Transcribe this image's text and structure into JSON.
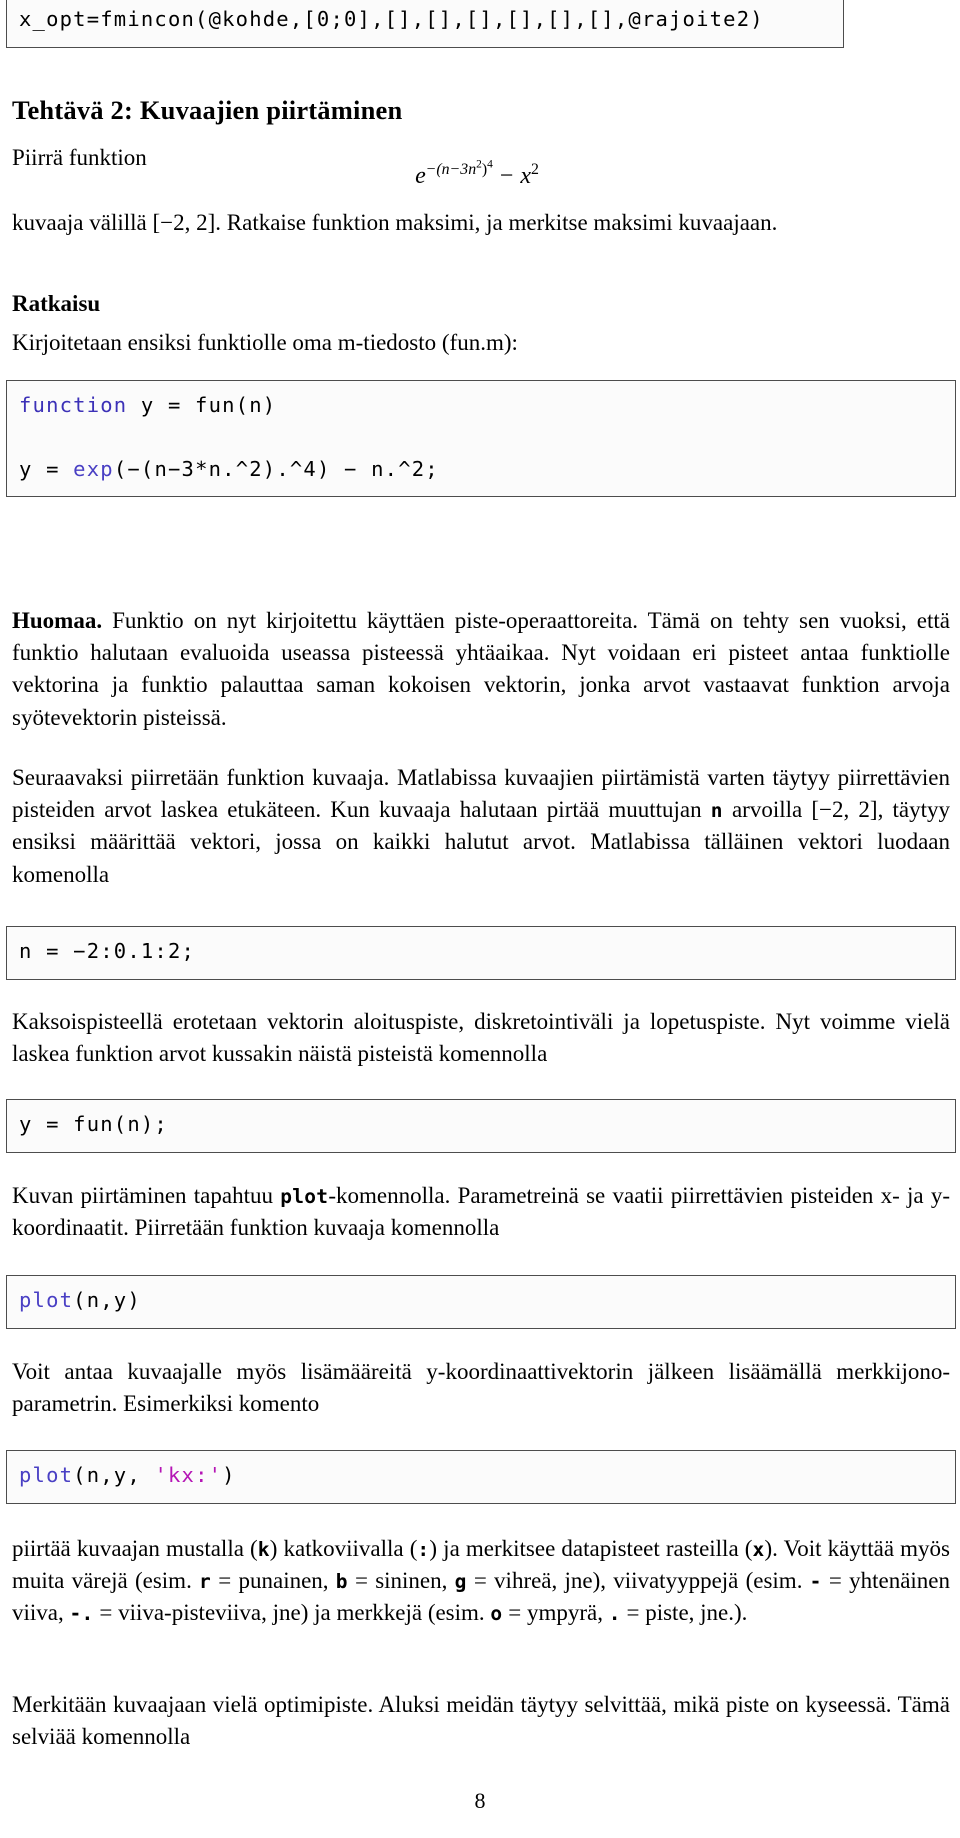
{
  "document": {
    "page_number": "8",
    "top_code_fragment": "x_opt=fmincon(@kohde,[0;0],[],[],[],[],[],[],@rajoite2)",
    "section_title": "Tehtävä 2: Kuvaajien piirtäminen",
    "intro_lead": "Piirrä funktion",
    "formula": {
      "base": "e",
      "exponent_text": "−(n−3n²)⁴",
      "exp_inner_lead": "−(n−3n",
      "exp_inner_sup": "2",
      "exp_inner_close": ")",
      "exp_outer_sup": "4",
      "minus": "−",
      "second_term_base": "x",
      "second_term_sup": "2",
      "plain": "e^{-(n-3n^2)^4} - x^2"
    },
    "intro_tail": "kuvaaja välillä [−2, 2]. Ratkaise funktion maksimi, ja merkitse maksimi kuvaajaan.",
    "solution_heading": "Ratkaisu",
    "para_mfile": "Kirjoitetaan ensiksi funktiolle oma m-tiedosto (fun.m):",
    "code_fun": {
      "keyword": "function",
      "line1_rest": " y = fun(n)",
      "line2_pre": "y = ",
      "line2_fn": "exp",
      "line2_rest": "(−(n−3*n.^2).^4) − n.^2;"
    },
    "para_huomaa": {
      "label": "Huomaa.",
      "text": " Funktio on nyt kirjoitettu käyttäen piste-operaattoreita. Tämä on tehty sen vuoksi, että funktio halutaan evaluoida useassa pisteessä yhtäaikaa. Nyt voidaan eri pisteet antaa funktiolle vektorina ja funktio palauttaa saman kokoisen vektorin, jonka arvot vastaavat funktion arvoja syötevektorin pisteissä."
    },
    "para_seuraavaksi_1": "Seuraavaksi piirretään funktion kuvaaja. Matlabissa kuvaajien piirtämistä varten täytyy piirrettävien pisteiden arvot laskea etukäteen. Kun kuvaaja halutaan pirtää muuttujan ",
    "para_seuraavaksi_mono": "n",
    "para_seuraavaksi_2": " arvoilla [−2, 2], täytyy ensiksi määrittää vektori, jossa on kaikki halutut arvot. Matlabissa tälläinen vektori luodaan komenolla",
    "code_n": "n = −2:0.1:2;",
    "para_kaksoispisteella": "Kaksoispisteellä erotetaan vektorin aloituspiste, diskretointiväli ja lopetuspiste. Nyt voimme vielä laskea funktion arvot kussakin näistä pisteistä komennolla",
    "code_y": "y = fun(n);",
    "para_kuvan_1": "Kuvan piirtäminen tapahtuu ",
    "para_kuvan_mono": "plot",
    "para_kuvan_2": "-komennolla. Parametreinä se vaatii piirrettävien pisteiden x- ja y-koordinaatit. Piirretään funktion kuvaaja komennolla",
    "code_plot": {
      "fn": "plot",
      "rest": "(n,y)"
    },
    "para_voit_antaa": "Voit antaa kuvaajalle myös lisämääreitä y-koordinaattivektorin jälkeen lisäämällä merkkijono-parametrin. Esimerkiksi komento",
    "code_plot_style": {
      "fn": "plot",
      "args_pre": "(n,y, ",
      "string": "'kx:'",
      "args_post": ")"
    },
    "para_piirtaa": {
      "seg1": "piirtää kuvaajan mustalla (",
      "m1": "k",
      "seg2": ") katkoviivalla (",
      "m2": ":",
      "seg3": ") ja merkitsee datapisteet rasteilla (",
      "m3": "x",
      "seg4": "). Voit käyttää myös muita värejä (esim. ",
      "m4": "r",
      "seg5": " = punainen, ",
      "m5": "b",
      "seg6": " = sininen, ",
      "m6": "g",
      "seg7": " = vihreä, jne), viivatyyppejä (esim. ",
      "m7": "-",
      "seg8": " = yhtenäinen viiva, ",
      "m8": "-.",
      "seg9": " = viiva-pisteviiva, jne) ja merkkejä (esim. ",
      "m9": "o",
      "seg10": " = ympyrä, ",
      "m10": ".",
      "seg11": " = piste, jne.)."
    },
    "para_merkitaan": "Merkitään kuvaajaan vielä optimipiste. Aluksi meidän täytyy selvittää, mikä piste on kyseessä. Tämä selviää komennolla"
  },
  "colors": {
    "keyword": "#3c31b7",
    "function": "#4a40c4",
    "string": "#b515b5",
    "box_border": "#4d4d4d",
    "box_background": "#fbfbfb",
    "text": "#000000"
  }
}
